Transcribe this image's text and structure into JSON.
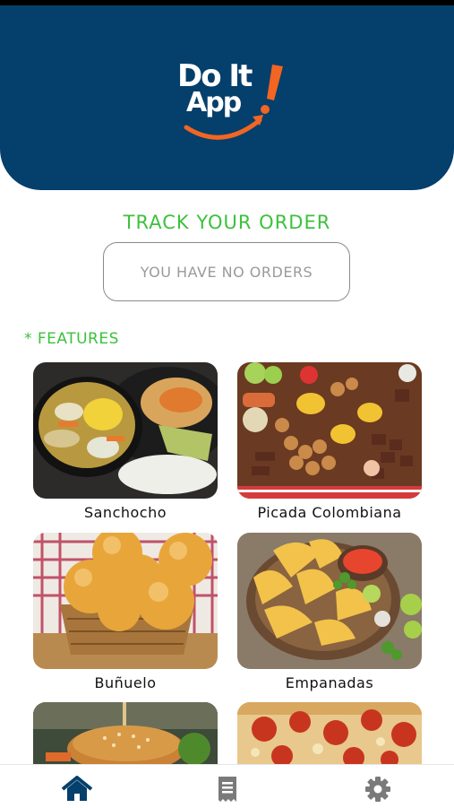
{
  "brand": {
    "logo_line1": "Do It",
    "logo_line2": "App",
    "header_color": "#053f6b",
    "accent_orange": "#f26522"
  },
  "track": {
    "title": "TRACK YOUR ORDER",
    "status": "YOU HAVE NO ORDERS"
  },
  "features": {
    "title": "* FEATURES",
    "items": [
      {
        "label": "Sanchocho",
        "image": "sancocho-soup-plate"
      },
      {
        "label": "Picada Colombiana",
        "image": "picada-platter"
      },
      {
        "label": "Buñuelo",
        "image": "bunuelo-basket"
      },
      {
        "label": "Empanadas",
        "image": "empanadas-bowl"
      },
      {
        "label": "",
        "image": "burger"
      },
      {
        "label": "",
        "image": "pizza"
      }
    ]
  },
  "nav": {
    "items": [
      {
        "icon": "home-icon",
        "active": true,
        "color": "#053f6b"
      },
      {
        "icon": "receipt-icon",
        "active": false,
        "color": "#7a7a7a"
      },
      {
        "icon": "gear-icon",
        "active": false,
        "color": "#7a7a7a"
      }
    ]
  }
}
